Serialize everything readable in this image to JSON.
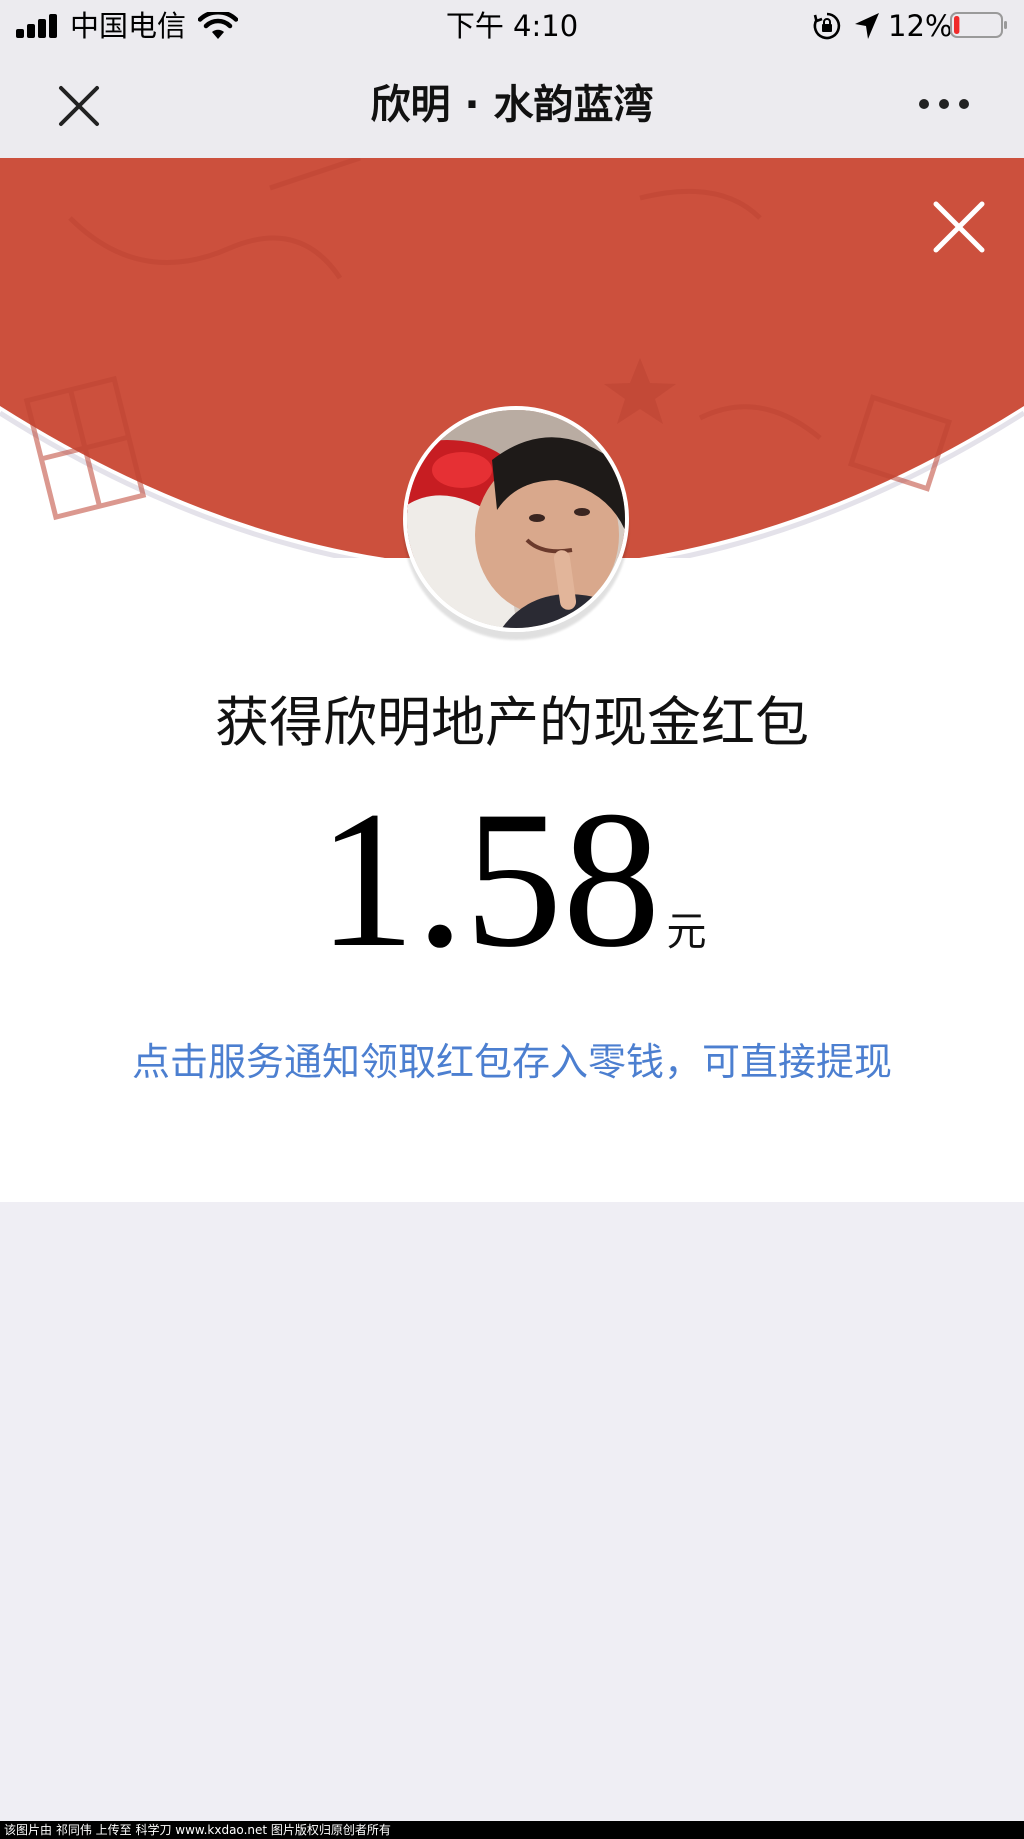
{
  "status_bar": {
    "carrier": "中国电信",
    "time": "下午 4:10",
    "battery_percent": "12%",
    "battery_level": 0.12,
    "icons": [
      "signal-icon",
      "wifi-icon",
      "orientation-lock-icon",
      "location-arrow-icon",
      "battery-icon"
    ]
  },
  "nav": {
    "title": "欣明 · 水韵蓝湾",
    "icons": [
      "close-icon",
      "more-icon"
    ]
  },
  "red_packet": {
    "title": "获得欣明地产的现金红包",
    "amount": "1.58",
    "unit": "元",
    "notice": "点击服务通知领取红包存入零钱，可直接提现",
    "icons": [
      "close-icon"
    ]
  },
  "footer": {
    "watermark": "该图片由 祁同伟 上传至 科学刀 www.kxdao.net 图片版权归原创者所有"
  },
  "colors": {
    "header_red": "#cc503d",
    "notice_blue": "#4c7fd0",
    "background": "#efeef4",
    "nav_background": "#ecebef"
  }
}
